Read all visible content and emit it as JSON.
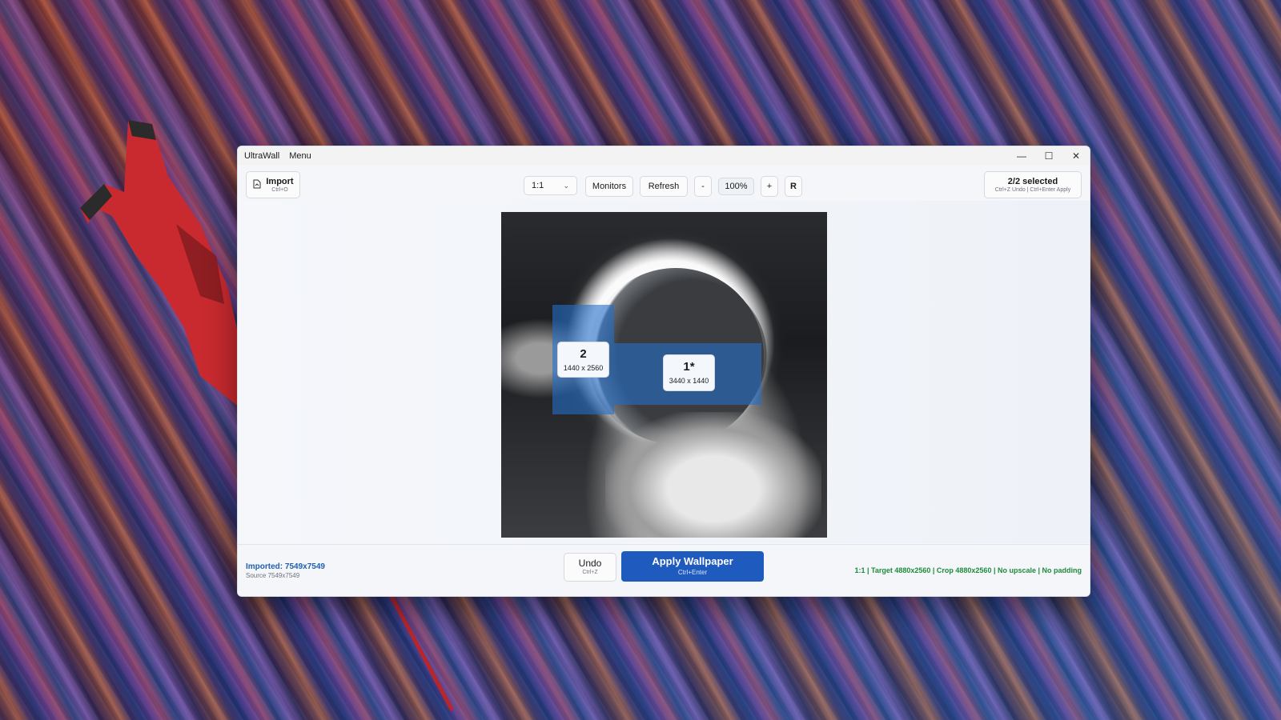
{
  "window": {
    "app_title": "UltraWall",
    "menu_label": "Menu"
  },
  "window_controls": {
    "minimize": "—",
    "maximize": "☐",
    "close": "✕"
  },
  "toolbar": {
    "import_label": "Import",
    "import_shortcut": "Ctrl+O",
    "ratio_value": "1:1",
    "monitors_label": "Monitors",
    "refresh_label": "Refresh",
    "zoom_out_label": "-",
    "zoom_value": "100%",
    "zoom_in_label": "+",
    "reset_label": "R",
    "selected_label": "2/2 selected",
    "selected_hint": "Ctrl+Z Undo  |  Ctrl+Enter Apply"
  },
  "crops": [
    {
      "number": "2",
      "resolution": "1440 x 2560"
    },
    {
      "number": "1*",
      "resolution": "3440 x 1440"
    }
  ],
  "status": {
    "imported": "Imported: 7549x7549",
    "source": "Source 7549x7549",
    "undo_label": "Undo",
    "undo_shortcut": "Ctrl+Z",
    "apply_label": "Apply Wallpaper",
    "apply_shortcut": "Ctrl+Enter",
    "summary": "1:1 | Target 4880x2560 | Crop 4880x2560 | No upscale | No padding"
  },
  "colors": {
    "accent": "#1f5bbf",
    "crop_overlay": "#236ec8",
    "status_ok": "#1e8a3c"
  }
}
